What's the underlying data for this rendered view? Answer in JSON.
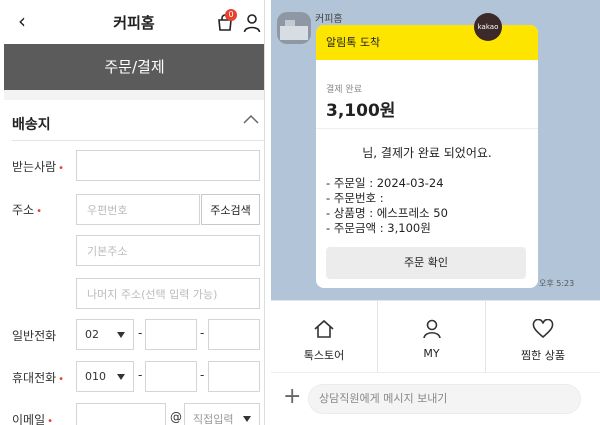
{
  "left": {
    "store_name": "커피홈",
    "cart_count": "0",
    "page_title": "주문/결제",
    "section_title": "배송지",
    "recipient_label": "받는사람",
    "address_label": "주소",
    "zipcode_placeholder": "우편번호",
    "address_search_button": "주소검색",
    "base_address_placeholder": "기본주소",
    "detail_address_placeholder": "나머지 주소(선택 입력 가능)",
    "phone_label": "일반전화",
    "phone_prefix": "02",
    "mobile_label": "휴대전화",
    "mobile_prefix": "010",
    "email_label": "이메일",
    "email_select": "직접입력",
    "at_symbol": "@",
    "dash": "-",
    "required_mark": "•"
  },
  "right": {
    "sender_name": "커피홈",
    "card_header": "알림톡 도착",
    "kakao_badge": "kakao",
    "payment_label": "결제 완료",
    "payment_amount": "3,100원",
    "message_main": "님, 결제가 완료 되었어요.",
    "order_date": "- 주문일 : 2024-03-24",
    "order_number": "- 주문번호 :",
    "product_name": "- 상품명 : 에스프레소 50",
    "order_amount": "- 주문금액 : 3,100원",
    "confirm_button": "주문 확인",
    "timestamp": "오후 5:23",
    "menu": [
      {
        "label": "톡스토어",
        "icon": "home-icon"
      },
      {
        "label": "MY",
        "icon": "person-icon"
      },
      {
        "label": "찜한 상품",
        "icon": "heart-icon"
      }
    ],
    "message_placeholder": "상담직원에게 메시지 보내기"
  },
  "colors": {
    "kakao_yellow": "#fee500",
    "chat_bg": "#b2c4d8",
    "title_bar": "#5b5b5b",
    "required_red": "#e8412c"
  }
}
